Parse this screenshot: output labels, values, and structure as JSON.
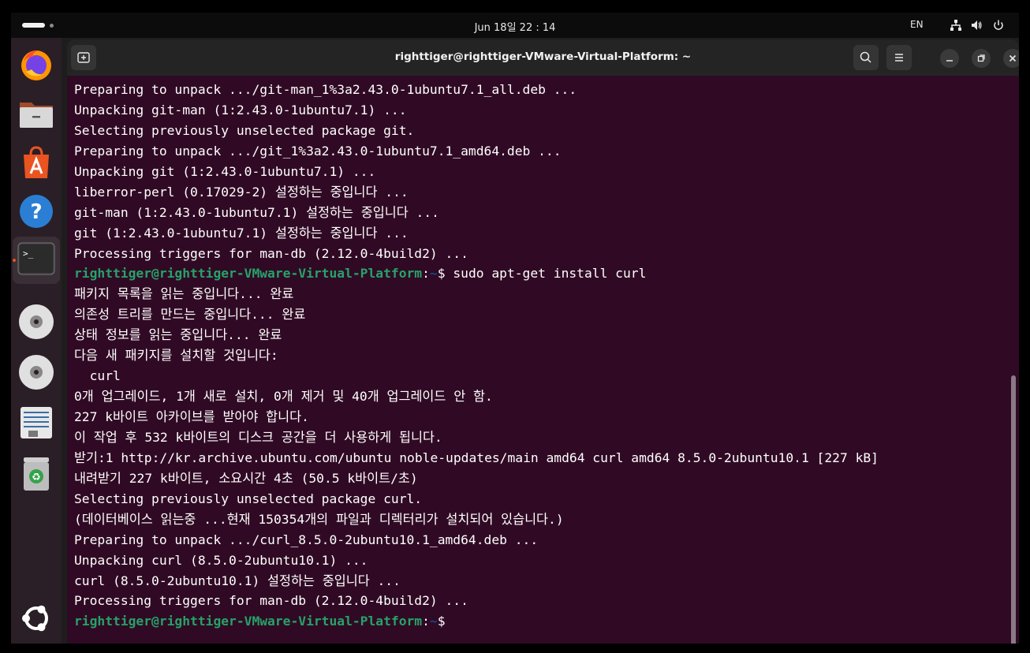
{
  "topbar": {
    "clock": "Jun 18일  22 : 14",
    "lang": "EN",
    "icons": [
      "network-icon",
      "volume-icon",
      "power-icon"
    ]
  },
  "dock": {
    "items": [
      "firefox-icon",
      "files-icon",
      "app-center-icon",
      "help-icon",
      "terminal-icon",
      "dvd-icon",
      "dvd-icon-2",
      "text-editor-icon",
      "trash-icon",
      "ubuntu-apps-icon"
    ]
  },
  "window": {
    "title": "righttiger@righttiger-VMware-Virtual-Platform: ~"
  },
  "terminal": {
    "prompt_user": "righttiger@righttiger-VMware-Virtual-Platform",
    "prompt_path": "~",
    "lines": [
      {
        "type": "out",
        "text": "Preparing to unpack .../git-man_1%3a2.43.0-1ubuntu7.1_all.deb ..."
      },
      {
        "type": "out",
        "text": "Unpacking git-man (1:2.43.0-1ubuntu7.1) ..."
      },
      {
        "type": "out",
        "text": "Selecting previously unselected package git."
      },
      {
        "type": "out",
        "text": "Preparing to unpack .../git_1%3a2.43.0-1ubuntu7.1_amd64.deb ..."
      },
      {
        "type": "out",
        "text": "Unpacking git (1:2.43.0-1ubuntu7.1) ..."
      },
      {
        "type": "out",
        "text": "liberror-perl (0.17029-2) 설정하는 중입니다 ..."
      },
      {
        "type": "out",
        "text": "git-man (1:2.43.0-1ubuntu7.1) 설정하는 중입니다 ..."
      },
      {
        "type": "out",
        "text": "git (1:2.43.0-1ubuntu7.1) 설정하는 중입니다 ..."
      },
      {
        "type": "out",
        "text": "Processing triggers for man-db (2.12.0-4build2) ..."
      },
      {
        "type": "prompt",
        "text": "$ sudo apt-get install curl"
      },
      {
        "type": "out",
        "text": "패키지 목록을 읽는 중입니다... 완료"
      },
      {
        "type": "out",
        "text": "의존성 트리를 만드는 중입니다... 완료"
      },
      {
        "type": "out",
        "text": "상태 정보를 읽는 중입니다... 완료"
      },
      {
        "type": "out",
        "text": "다음 새 패키지를 설치할 것입니다:"
      },
      {
        "type": "out",
        "text": "  curl"
      },
      {
        "type": "out",
        "text": "0개 업그레이드, 1개 새로 설치, 0개 제거 및 40개 업그레이드 안 함."
      },
      {
        "type": "out",
        "text": "227 k바이트 아카이브를 받아야 합니다."
      },
      {
        "type": "out",
        "text": "이 작업 후 532 k바이트의 디스크 공간을 더 사용하게 됩니다."
      },
      {
        "type": "out",
        "text": "받기:1 http://kr.archive.ubuntu.com/ubuntu noble-updates/main amd64 curl amd64 8.5.0-2ubuntu10.1 [227 kB]"
      },
      {
        "type": "out",
        "text": "내려받기 227 k바이트, 소요시간 4초 (50.5 k바이트/초)"
      },
      {
        "type": "out",
        "text": "Selecting previously unselected package curl."
      },
      {
        "type": "out",
        "text": "(데이터베이스 읽는중 ...현재 150354개의 파일과 디렉터리가 설치되어 있습니다.)"
      },
      {
        "type": "out",
        "text": "Preparing to unpack .../curl_8.5.0-2ubuntu10.1_amd64.deb ..."
      },
      {
        "type": "out",
        "text": "Unpacking curl (8.5.0-2ubuntu10.1) ..."
      },
      {
        "type": "out",
        "text": "curl (8.5.0-2ubuntu10.1) 설정하는 중입니다 ..."
      },
      {
        "type": "out",
        "text": "Processing triggers for man-db (2.12.0-4build2) ..."
      },
      {
        "type": "prompt",
        "text": "$ "
      }
    ]
  }
}
